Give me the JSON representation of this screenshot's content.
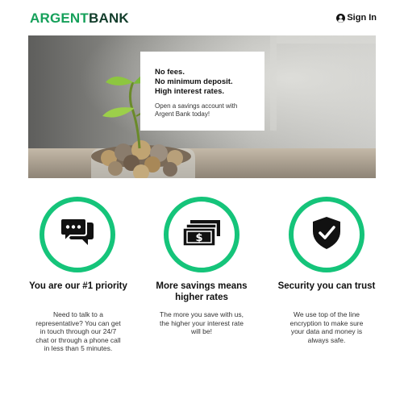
{
  "brand": {
    "part1": "ARGENT",
    "part2": "BANK",
    "color_primary": "#15a05a",
    "color_dark": "#123d2b"
  },
  "header": {
    "signin_label": "Sign In",
    "signin_icon": "user-circle-icon"
  },
  "hero": {
    "lines": [
      "No fees.",
      "No minimum deposit.",
      "High interest rates."
    ],
    "subtext": "Open a savings account with Argent Bank today!",
    "image": "plant-in-coin-jar"
  },
  "features": [
    {
      "icon": "chat-icon",
      "title": "You are our #1 priority",
      "text": "Need to talk to a representative? You can get in touch through our 24/7 chat or through a phone call in less than 5 minutes."
    },
    {
      "icon": "money-icon",
      "title": "More savings means higher rates",
      "text": "The more you save with us, the higher your interest rate will be!"
    },
    {
      "icon": "security-shield-icon",
      "title": "Security you can trust",
      "text": "We use top of the line encryption to make sure your data and money is always safe."
    }
  ],
  "colors": {
    "accent_ring": "#15c47a"
  }
}
